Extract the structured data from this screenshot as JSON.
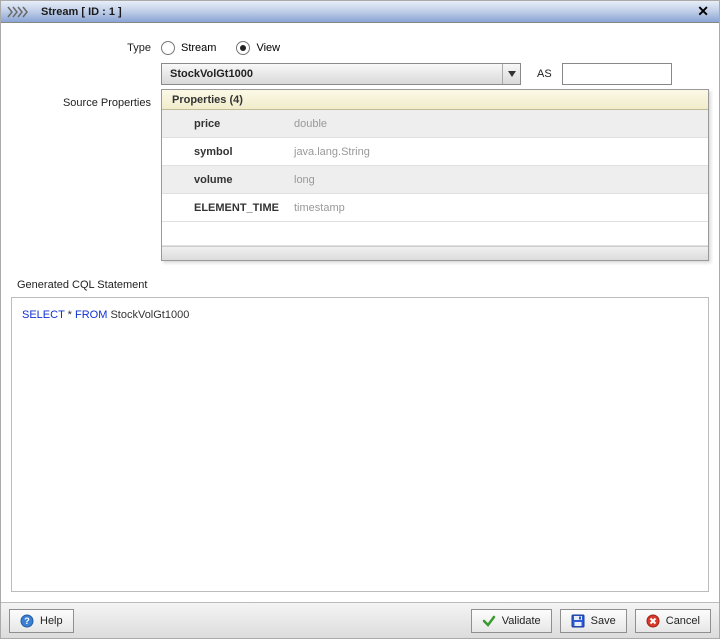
{
  "titlebar": {
    "title": "Stream [ ID : 1 ]"
  },
  "form": {
    "type_label": "Type",
    "radio_stream": "Stream",
    "radio_view": "View",
    "type_selected": "view",
    "source_select": "StockVolGt1000",
    "as_label": "AS",
    "as_value": "",
    "source_props_label": "Source Properties"
  },
  "props": {
    "header": "Properties (4)",
    "rows": [
      {
        "name": "price",
        "type": "double"
      },
      {
        "name": "symbol",
        "type": "java.lang.String"
      },
      {
        "name": "volume",
        "type": "long"
      },
      {
        "name": "ELEMENT_TIME",
        "type": "timestamp"
      }
    ]
  },
  "cql": {
    "label": "Generated CQL Statement",
    "kw_select": "SELECT",
    "star": " * ",
    "kw_from": "FROM",
    "body": " StockVolGt1000"
  },
  "footer": {
    "help": "Help",
    "validate": "Validate",
    "save": "Save",
    "cancel": "Cancel"
  }
}
